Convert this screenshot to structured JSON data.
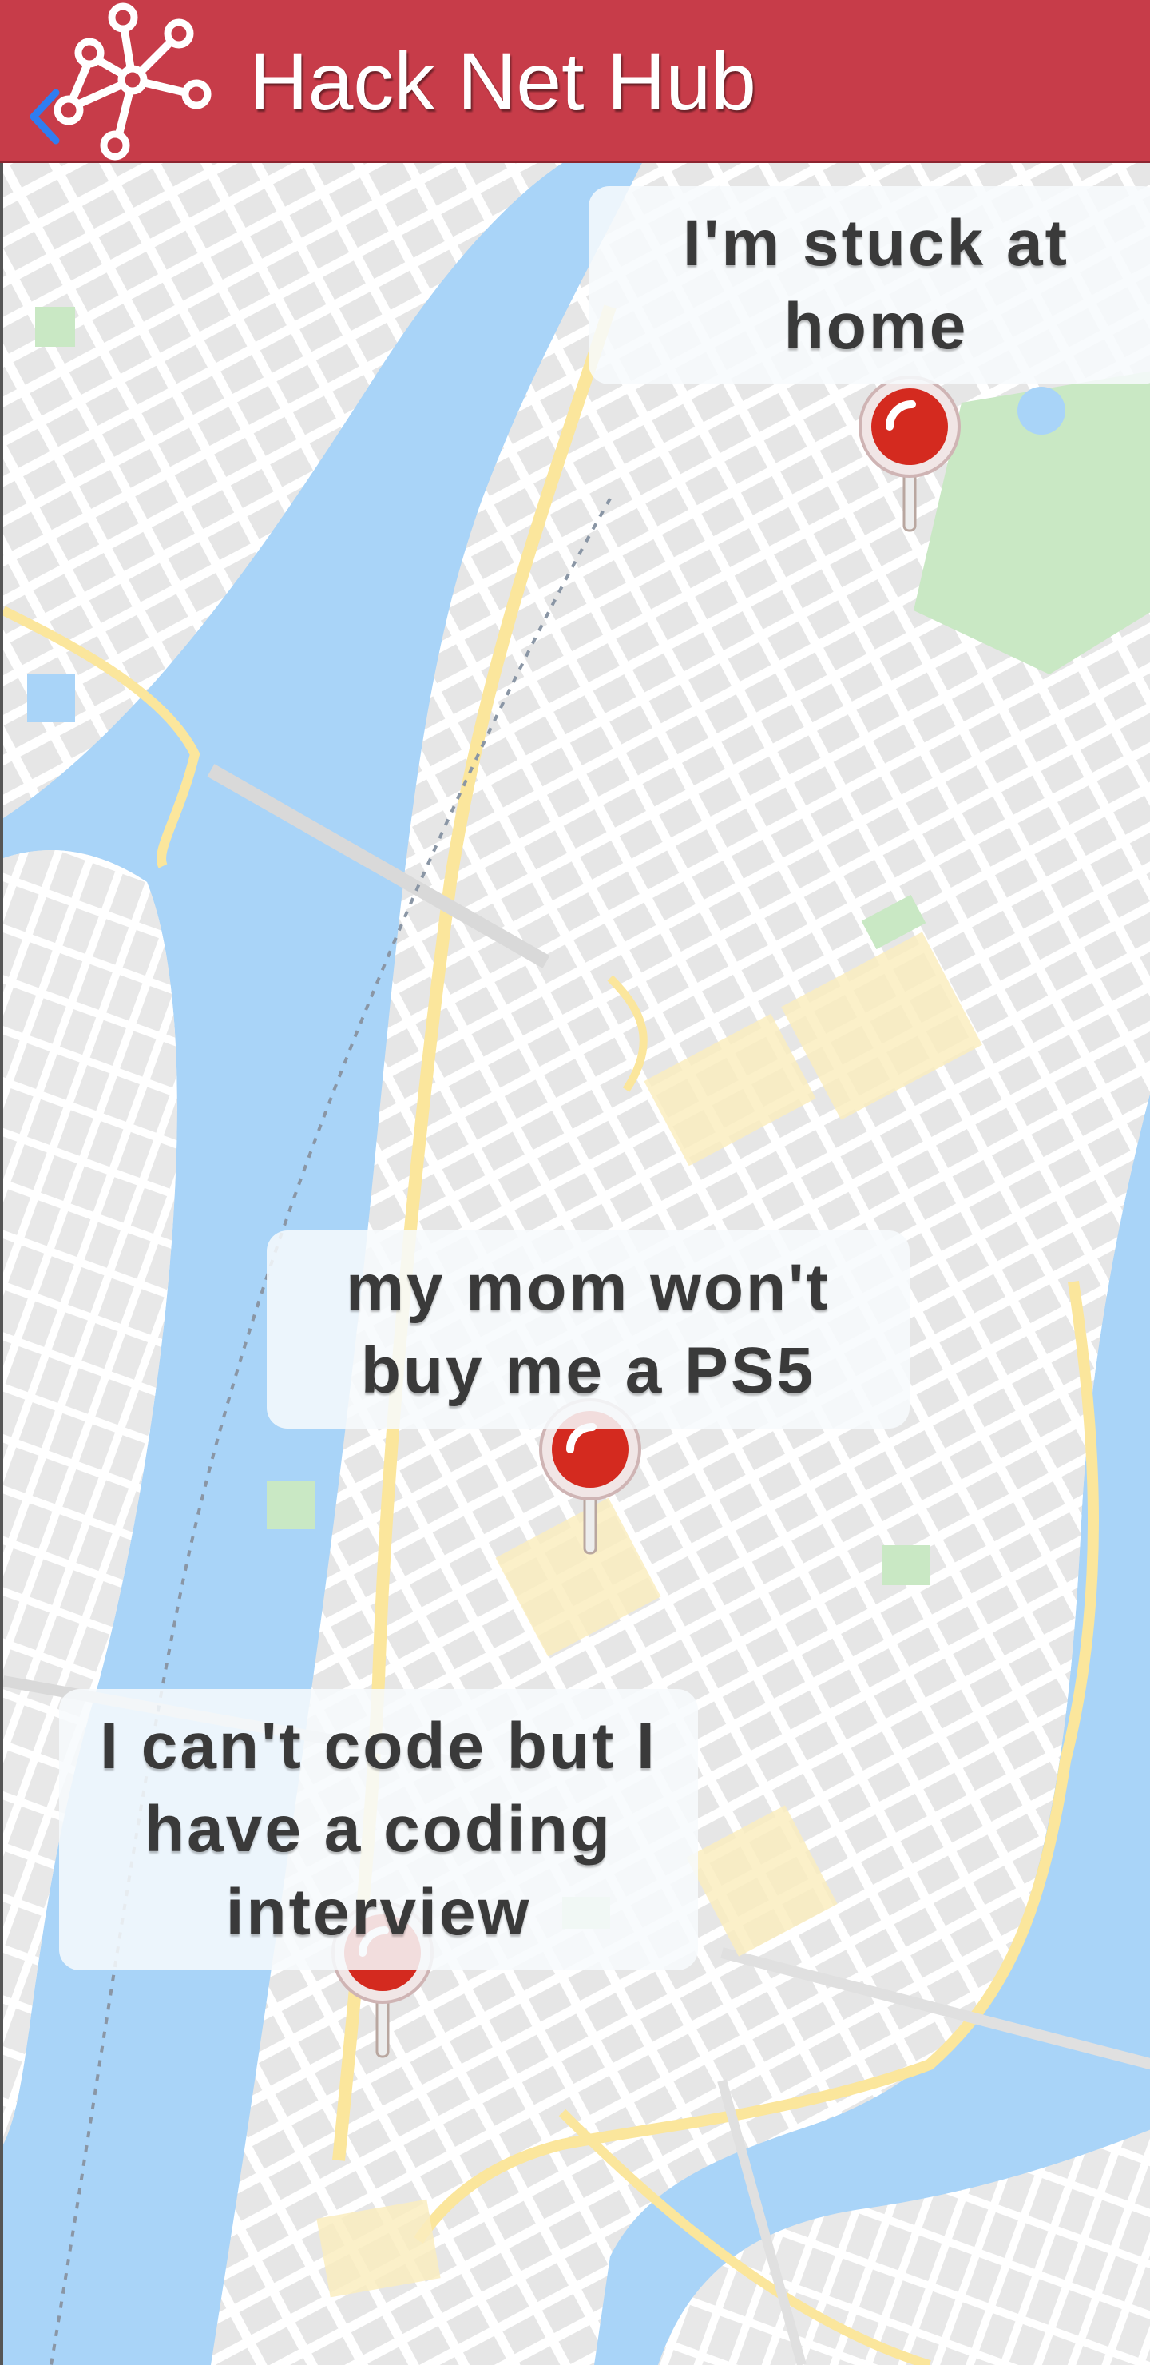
{
  "header": {
    "title": "Hack Net Hub",
    "logo_icon": "network-nodes-icon",
    "back_icon": "chevron-left-icon",
    "background_color": "#c73c49"
  },
  "map": {
    "water_color": "#a9d4f8",
    "park_color": "#c9e8c4",
    "road_color": "#ffffff",
    "highway_color": "#fbe69c"
  },
  "pins": [
    {
      "text": "I'm stuck at home",
      "icon": "map-pin-icon",
      "pin_color": "#d42a1f"
    },
    {
      "text": "my mom won't buy me a PS5",
      "icon": "map-pin-icon",
      "pin_color": "#d42a1f"
    },
    {
      "text": "I can't code but I have a coding interview",
      "icon": "map-pin-icon",
      "pin_color": "#d42a1f"
    }
  ]
}
